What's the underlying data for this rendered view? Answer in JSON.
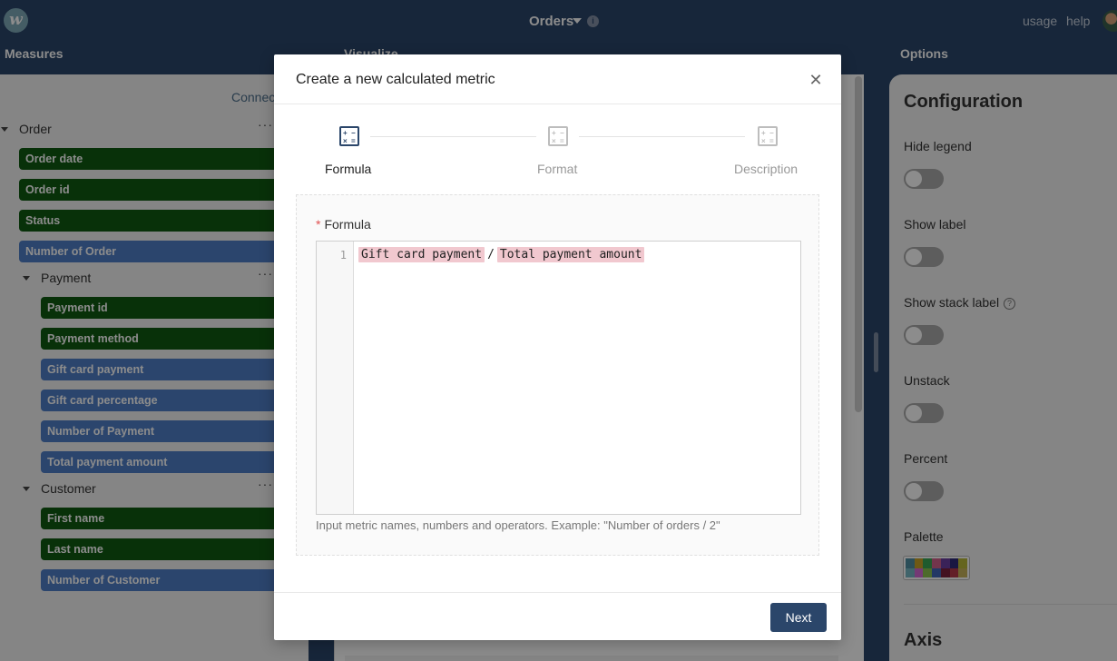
{
  "app": {
    "logo_text": "w",
    "page_title": "Orders",
    "nav": {
      "usage": "usage",
      "help": "help"
    }
  },
  "sections": {
    "measures": "Measures",
    "visualize": "Visualize",
    "options": "Options"
  },
  "measures": {
    "connect_label": "Connect",
    "groups": [
      {
        "label": "Order",
        "items": [
          {
            "label": "Order date",
            "kind": "dimension"
          },
          {
            "label": "Order id",
            "kind": "dimension"
          },
          {
            "label": "Status",
            "kind": "dimension"
          },
          {
            "label": "Number of Order",
            "kind": "metric"
          }
        ]
      },
      {
        "label": "Payment",
        "items": [
          {
            "label": "Payment id",
            "kind": "dimension"
          },
          {
            "label": "Payment method",
            "kind": "dimension"
          },
          {
            "label": "Gift card payment",
            "kind": "metric"
          },
          {
            "label": "Gift card percentage",
            "kind": "metric"
          },
          {
            "label": "Number of Payment",
            "kind": "metric"
          },
          {
            "label": "Total payment amount",
            "kind": "metric"
          }
        ]
      },
      {
        "label": "Customer",
        "items": [
          {
            "label": "First name",
            "kind": "dimension"
          },
          {
            "label": "Last name",
            "kind": "dimension"
          },
          {
            "label": "Number of Customer",
            "kind": "metric"
          }
        ]
      }
    ],
    "more_glyph": "···"
  },
  "options": {
    "configuration_title": "Configuration",
    "toggles": [
      {
        "label": "Hide legend",
        "on": false
      },
      {
        "label": "Show label",
        "on": false
      },
      {
        "label": "Show stack label",
        "on": false,
        "help": true
      },
      {
        "label": "Unstack",
        "on": false
      },
      {
        "label": "Percent",
        "on": false
      }
    ],
    "palette_label": "Palette",
    "palette_colors": [
      "#4f8fa3",
      "#c9a227",
      "#3aa655",
      "#d1628a",
      "#6a3fa0",
      "#2e2a78",
      "#b8b83a",
      "#76b6c4",
      "#d46bd6",
      "#8cc24f",
      "#4066b8",
      "#7a1f3d",
      "#b5394a",
      "#c7b35a"
    ],
    "axis_title": "Axis"
  },
  "modal": {
    "title": "Create a new calculated metric",
    "close_glyph": "✕",
    "steps": [
      {
        "label": "Formula",
        "active": true
      },
      {
        "label": "Format",
        "active": false
      },
      {
        "label": "Description",
        "active": false
      }
    ],
    "formula": {
      "label": "Formula",
      "required_mark": "*",
      "line_number": "1",
      "tokens": [
        "Gift card payment",
        "Total payment amount"
      ],
      "operator": "/",
      "hint": "Input metric names, numbers and operators. Example: \"Number of orders / 2\""
    },
    "next_label": "Next"
  },
  "colors": {
    "navy": "#2b466a",
    "dimension_green": "#0f5a12",
    "metric_blue": "#4f7ec6",
    "token_pink": "#f1c8cf"
  }
}
